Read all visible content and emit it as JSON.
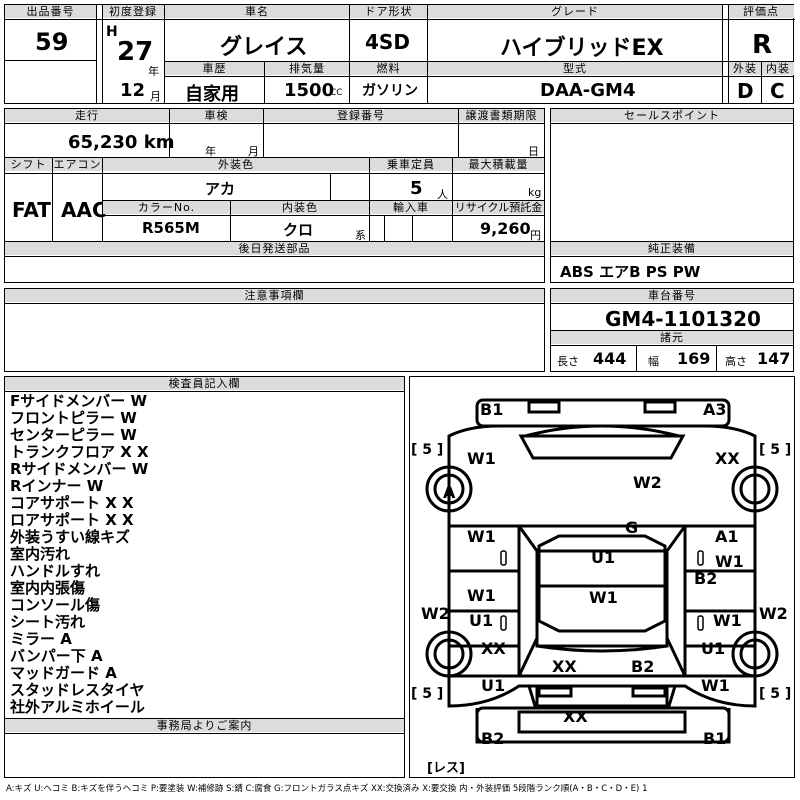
{
  "sheet": {
    "lot_no_label": "出品番号",
    "lot_no": "59",
    "first_reg_label": "初度登録",
    "era": "H",
    "first_reg_year": "27",
    "year_unit": "年",
    "first_reg_month": "12",
    "month_unit": "月",
    "car_name_label": "車名",
    "car_name": "グレイス",
    "door_label": "ドア形状",
    "door": "4SD",
    "grade_label": "グレード",
    "grade": "ハイブリッドEX",
    "score_label": "評価点",
    "score": "R",
    "history_label": "車歴",
    "history": "自家用",
    "displacement_label": "排気量",
    "displacement": "1500",
    "cc_unit": "CC",
    "fuel_label": "燃料",
    "fuel": "ガソリン",
    "model_label": "型式",
    "model": "DAA-GM4",
    "ext_score_label": "外装",
    "ext_score": "D",
    "int_score_label": "内装",
    "int_score": "C",
    "mileage_label": "走行",
    "mileage": "65,230 km",
    "inspection_label": "車検",
    "year_label": "年",
    "month_label": "月",
    "reg_no_label": "登録番号",
    "transfer_label": "譲渡書類期限",
    "day_label": "日",
    "shift_label": "シフト",
    "shift": "FAT",
    "ac_label": "エアコン",
    "ac": "AAC",
    "color_label": "外装色",
    "color": "アカ",
    "capacity_label": "乗車定員",
    "capacity": "5",
    "person_unit": "人",
    "load_label": "最大積載量",
    "kg_unit": "kg",
    "color_no_label": "カラーNo.",
    "color_no": "R565M",
    "interior_color_label": "内装色",
    "interior_color": "クロ",
    "kei_unit": "系",
    "import_label": "輸入車",
    "recycle_label": "リサイクル預託金",
    "recycle": "9,260",
    "yen_unit": "円",
    "later_parts_label": "後日発送部品",
    "sales_point_label": "セールスポイント",
    "equip_label": "純正装備",
    "equip": "ABS エアB PS PW",
    "notes_label": "注意事項欄",
    "chassis_label": "車台番号",
    "chassis": "GM4-1101320",
    "spec_label": "諸元",
    "length_label": "長さ",
    "length": "444",
    "width_label": "幅",
    "width": "169",
    "height_label": "高さ",
    "height": "147",
    "inspector_label": "検査員記入欄",
    "inspector_notes": [
      "Fサイドメンバー W",
      "フロントピラー W",
      "センターピラー W",
      "トランクフロア X X",
      "Rサイドメンバー W",
      "Rインナー W",
      "コアサポート X X",
      "ロアサポート X X",
      "外装うすい線キズ",
      "室内汚れ",
      "ハンドルすれ",
      "室内内張傷",
      "コンソール傷",
      "シート汚れ",
      "ミラー A",
      "バンパー下 A",
      "マッドガード A",
      "スタッドレスタイヤ",
      "社外アルミホイール"
    ],
    "office_label": "事務局よりご案内",
    "legend": "A:キズ U:ヘコミ B:キズを伴うヘコミ P:要塗装 W:補修跡 S:錆 C:腐食 G:フロントガラス点キズ XX:交換済み X:要交換 内・外装評価 5段階ランク順(A・B・C・D・E) 1"
  },
  "diagram": {
    "tire_fl": "[ 5 ]",
    "tire_fr": "[ 5 ]",
    "tire_rl": "[ 5 ]",
    "tire_rr": "[ 5 ]",
    "spare": "[レス]",
    "marks": {
      "front_left": "B1",
      "front_right": "A3",
      "l_fender": "W1",
      "r_fender": "XX",
      "l_wheel_front": "A",
      "hood": "W2",
      "windshield": "G",
      "l_front_door": "W1",
      "r_front_door_a": "A1",
      "r_front_door_w": "W1",
      "roof": "U1",
      "r_pillar": "B2",
      "l_rear_door_w": "W1",
      "l_rear_door_u": "U1",
      "center": "W1",
      "l_side": "W2",
      "r_side": "W2",
      "r_rear_door": "W1",
      "l_rear_wheel": "XX",
      "r_rear_wheel": "U1",
      "trunk_xx": "XX",
      "trunk_b2": "B2",
      "l_rear_fender": "U1",
      "r_rear_fender": "W1",
      "rear_bumper": "XX",
      "rear_left": "B2",
      "rear_right": "B1"
    }
  }
}
